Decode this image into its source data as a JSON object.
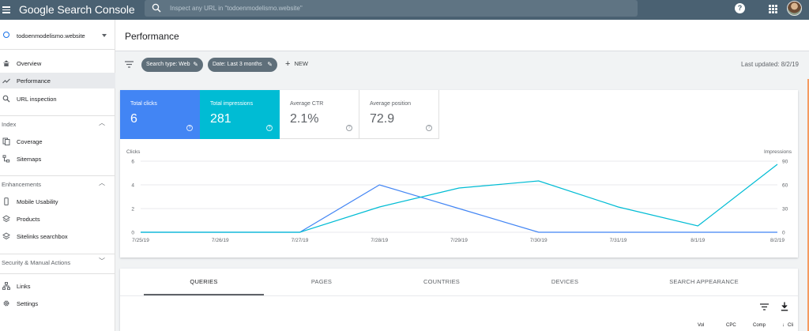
{
  "app": {
    "title": "Google Search Console"
  },
  "search": {
    "placeholder": "Inspect any URL in \"todoenmodelismo.website\""
  },
  "icons": {
    "menu": "hamburger-menu-icon",
    "search": "search-icon",
    "help": "help-icon",
    "apps": "apps-grid-icon",
    "account": "account-avatar"
  },
  "sidebar": {
    "property": "todoenmodelismo.website",
    "items": [
      {
        "label": "Overview",
        "icon": "home-icon",
        "active": false
      },
      {
        "label": "Performance",
        "icon": "trending-up-icon",
        "active": true
      },
      {
        "label": "URL inspection",
        "icon": "search-icon",
        "active": false
      }
    ],
    "sections": [
      {
        "label": "Index",
        "expanded": true,
        "items": [
          {
            "label": "Coverage",
            "icon": "copy-icon"
          },
          {
            "label": "Sitemaps",
            "icon": "sitemap-icon"
          }
        ]
      },
      {
        "label": "Enhancements",
        "expanded": true,
        "items": [
          {
            "label": "Mobile Usability",
            "icon": "smartphone-icon"
          },
          {
            "label": "Products",
            "icon": "layers-icon"
          },
          {
            "label": "Sitelinks searchbox",
            "icon": "layers-icon"
          }
        ]
      },
      {
        "label": "Security & Manual Actions",
        "expanded": false,
        "items": []
      }
    ],
    "footer_items": [
      {
        "label": "Links",
        "icon": "links-icon"
      },
      {
        "label": "Settings",
        "icon": "gear-icon"
      }
    ]
  },
  "page": {
    "title": "Performance",
    "filters": [
      {
        "label": "Search type: Web"
      },
      {
        "label": "Date: Last 3 months"
      }
    ],
    "new_label": "NEW",
    "last_updated": "Last updated: 8/2/19"
  },
  "metrics": [
    {
      "label": "Total clicks",
      "value": "6",
      "style": "blue"
    },
    {
      "label": "Total impressions",
      "value": "281",
      "style": "teal"
    },
    {
      "label": "Average CTR",
      "value": "2.1%",
      "style": "white"
    },
    {
      "label": "Average position",
      "value": "72.9",
      "style": "white"
    }
  ],
  "chart_data": {
    "type": "line",
    "x": [
      "7/25/19",
      "7/26/19",
      "7/27/19",
      "7/28/19",
      "7/29/19",
      "7/30/19",
      "7/31/19",
      "8/1/19",
      "8/2/19"
    ],
    "series": [
      {
        "name": "Clicks",
        "axis": "left",
        "color": "#4285f4",
        "values": [
          0,
          0,
          0,
          4,
          2,
          0,
          0,
          0,
          0
        ]
      },
      {
        "name": "Impressions",
        "axis": "right",
        "color": "#00bcd4",
        "values": [
          0,
          0,
          0,
          32,
          56,
          65,
          32,
          8,
          86
        ]
      }
    ],
    "ylabel_left": "Clicks",
    "ylabel_right": "Impressions",
    "yticks_left": [
      "0",
      "2",
      "4",
      "6"
    ],
    "yticks_right": [
      "0",
      "30",
      "60",
      "90"
    ],
    "ylim_left": [
      0,
      6
    ],
    "ylim_right": [
      0,
      90
    ],
    "grid": true
  },
  "tabs": [
    {
      "label": "QUERIES",
      "active": true
    },
    {
      "label": "PAGES",
      "active": false
    },
    {
      "label": "COUNTRIES",
      "active": false
    },
    {
      "label": "DEVICES",
      "active": false
    },
    {
      "label": "SEARCH APPEARANCE",
      "active": false
    }
  ],
  "table": {
    "column_headers": [
      "Vol",
      "CPC",
      "Comp",
      "Cli"
    ]
  }
}
